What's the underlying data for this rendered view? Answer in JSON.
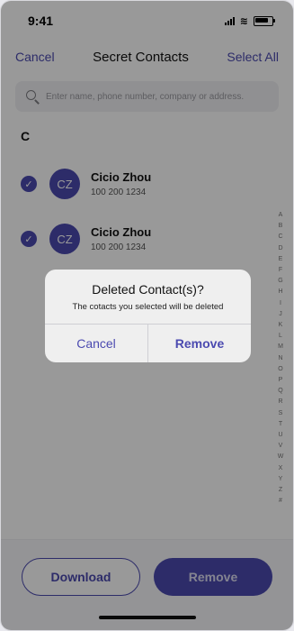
{
  "status": {
    "time": "9:41"
  },
  "nav": {
    "cancel": "Cancel",
    "title": "Secret Contacts",
    "select_all": "Select All"
  },
  "search": {
    "placeholder": "Enter name, phone number, company or address."
  },
  "section": "C",
  "contacts": [
    {
      "initials": "CZ",
      "name": "Cicio Zhou",
      "phone": "100 200 1234",
      "selected": true
    },
    {
      "initials": "CZ",
      "name": "Cicio Zhou",
      "phone": "100 200 1234",
      "selected": true
    }
  ],
  "index_letters": [
    "A",
    "B",
    "C",
    "D",
    "E",
    "F",
    "G",
    "H",
    "I",
    "J",
    "K",
    "L",
    "M",
    "N",
    "O",
    "P",
    "Q",
    "R",
    "S",
    "T",
    "U",
    "V",
    "W",
    "X",
    "Y",
    "Z",
    "#"
  ],
  "bottom": {
    "download": "Download",
    "remove": "Remove"
  },
  "dialog": {
    "title": "Deleted Contact(s)?",
    "message": "The cotacts you selected will be deleted",
    "cancel": "Cancel",
    "remove": "Remove"
  },
  "colors": {
    "accent": "#4b4ab0",
    "overlay": "rgba(0,0,0,0.40)"
  }
}
